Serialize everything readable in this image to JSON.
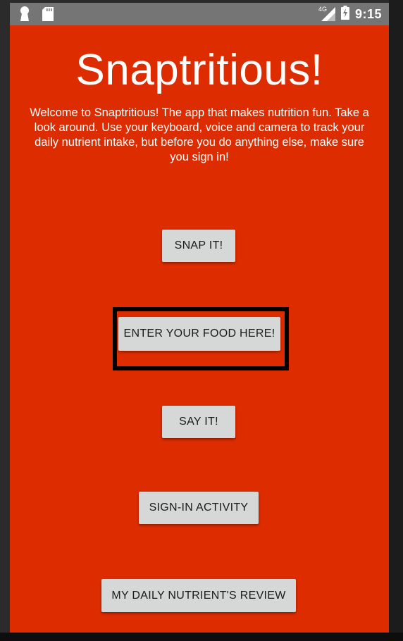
{
  "status_bar": {
    "time": "9:15",
    "network": "4G",
    "left_icons": [
      "keyhole-icon",
      "sd-card-icon"
    ],
    "right_icons": [
      "signal-icon",
      "battery-icon"
    ]
  },
  "app": {
    "title": "Snaptritious!",
    "welcome_text": "Welcome to Snaptritious! The app that makes nutrition fun. Take a look around. Use your keyboard, voice and camera to track your daily nutrient intake, but before you do anything else, make sure you sign in!"
  },
  "buttons": {
    "snap_it": "SNAP IT!",
    "enter_food": "ENTER YOUR FOOD HERE!",
    "say_it": "SAY IT!",
    "sign_in": "SIGN-IN ACTIVITY",
    "daily_review": "MY DAILY NUTRIENT'S REVIEW"
  },
  "colors": {
    "background": "#dd2c00",
    "status_bar": "#757575",
    "button": "#d6d7d7",
    "highlight": "#000000"
  }
}
